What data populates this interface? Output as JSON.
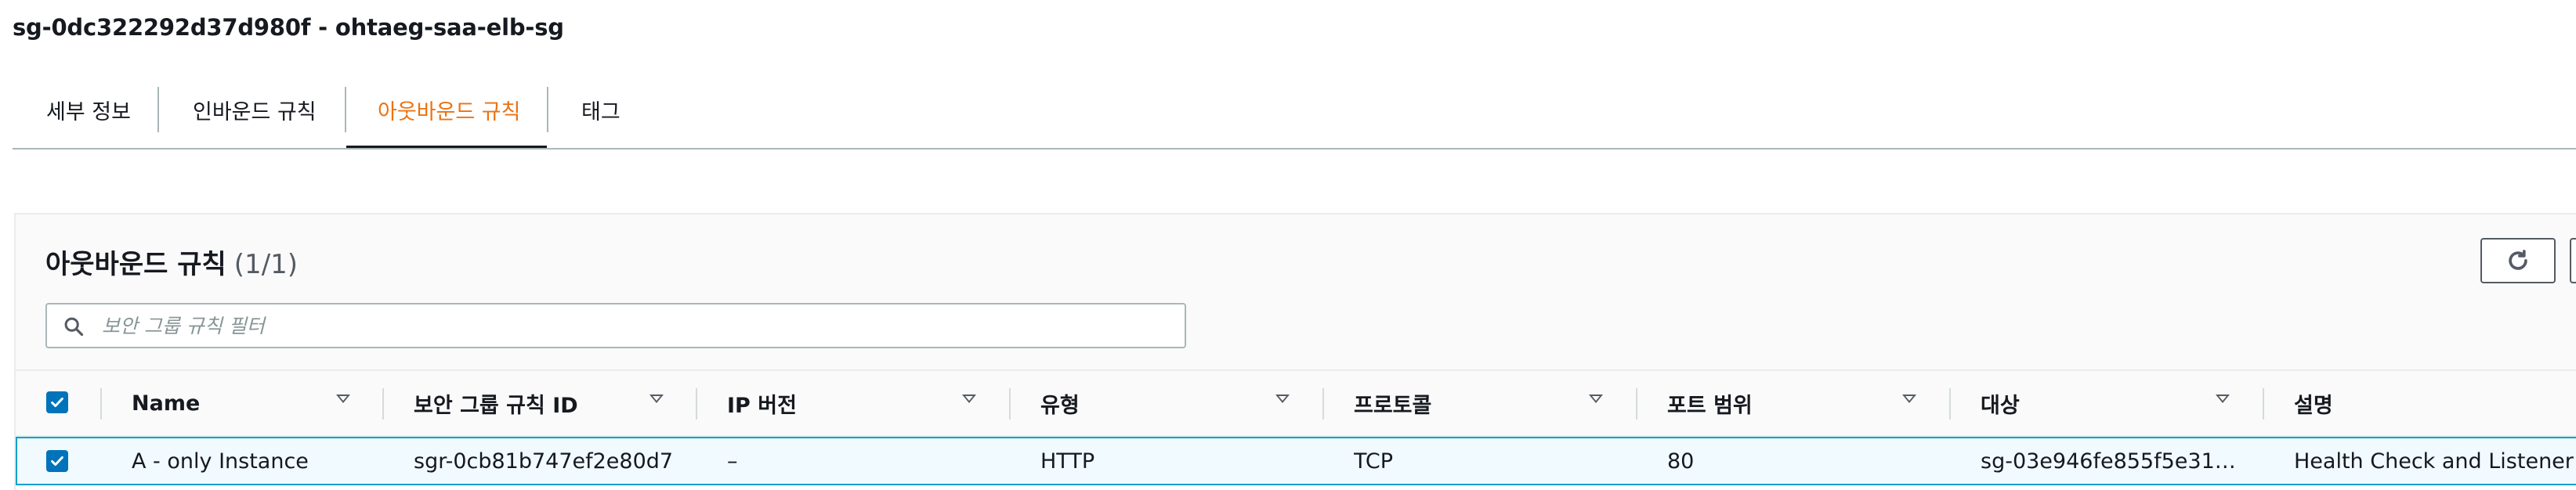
{
  "page": {
    "title": "sg-0dc322292d37d980f - ohtaeg-saa-elb-sg"
  },
  "tabs": [
    {
      "label": "세부 정보",
      "active": false
    },
    {
      "label": "인바운드 규칙",
      "active": false
    },
    {
      "label": "아웃바운드 규칙",
      "active": true
    },
    {
      "label": "태그",
      "active": false
    }
  ],
  "panel": {
    "title": "아웃바운드 규칙",
    "count": "(1/1)",
    "search_placeholder": "보안 그룹 규칙 필터",
    "refresh_icon": "refresh-icon"
  },
  "table": {
    "select_all_checked": true,
    "columns": [
      "Name",
      "보안 그룹 규칙 ID",
      "IP 버전",
      "유형",
      "프로토콜",
      "포트 범위",
      "대상",
      "설명"
    ],
    "rows": [
      {
        "checked": true,
        "name": "A - only Instance",
        "rule_id": "sgr-0cb81b747ef2e80d7",
        "ip_version": "–",
        "type": "HTTP",
        "protocol": "TCP",
        "port_range": "80",
        "destination": "sg-03e946fe855f5e31…",
        "description": "Health Check and Listener"
      }
    ]
  },
  "colors": {
    "accent_orange": "#ec7211",
    "selected_blue": "#0073bb",
    "row_border": "#00a1c9",
    "row_bg": "#f1faff"
  }
}
